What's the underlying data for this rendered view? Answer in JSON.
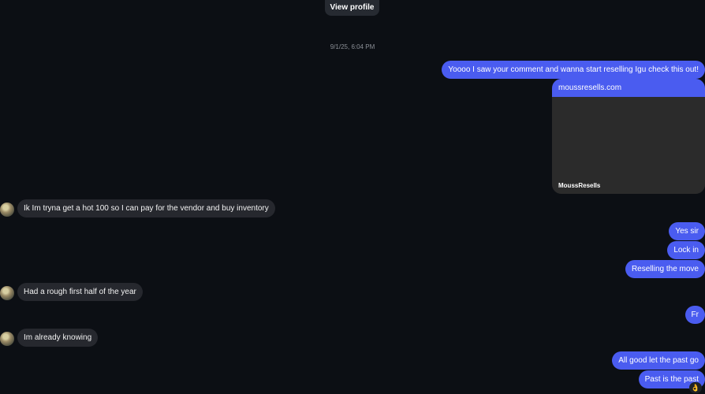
{
  "header": {
    "view_profile_label": "View profile"
  },
  "timestamp": "9/1/25, 6:04 PM",
  "messages": {
    "m1": "Yoooo I saw your comment and wanna start reselling Igu check this out!",
    "link_card": {
      "url": "moussresells.com",
      "site_name": "MoussResells"
    },
    "m2": "Ik Im tryna get a hot 100 so I can pay for the vendor and buy inventory",
    "m3": "Yes sir",
    "m4": "Lock in",
    "m5": "Reselling the move",
    "m6": "Had a rough first half of the year",
    "m7": "Fr",
    "m8": "Im already knowing",
    "m9": "All good let the past go",
    "m10": "Past is the past"
  },
  "reaction": {
    "emoji": "👌"
  },
  "colors": {
    "background": "#0c0f14",
    "outgoing_bubble": "#4a5cf0",
    "incoming_bubble": "#26282e"
  }
}
